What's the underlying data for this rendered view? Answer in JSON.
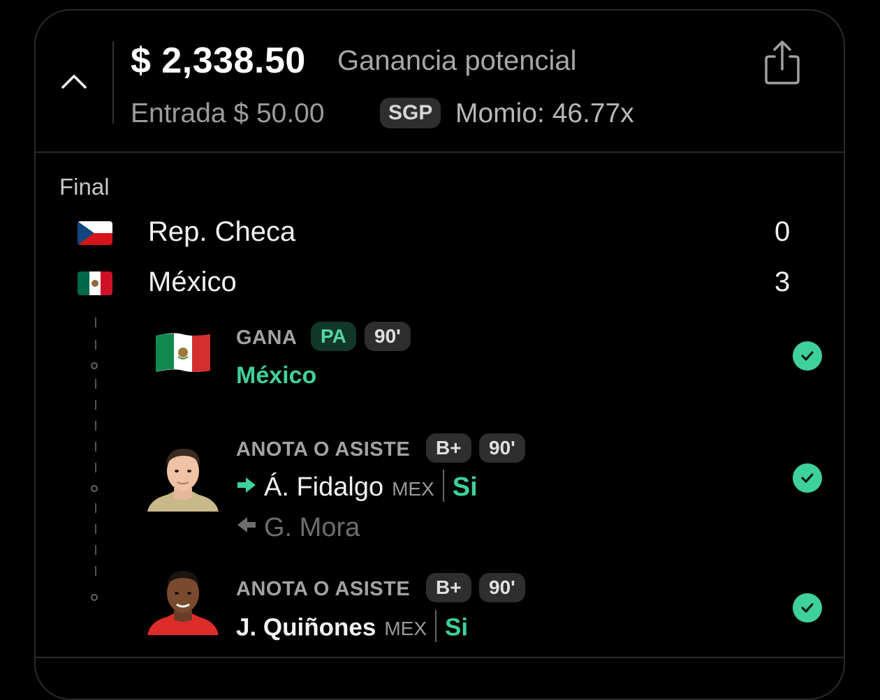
{
  "header": {
    "payout": "$ 2,338.50",
    "payout_label": "Ganancia potencial",
    "entry": "Entrada $ 50.00",
    "sgp_badge": "SGP",
    "odds": "Momio: 46.77x"
  },
  "match": {
    "status": "Final",
    "teams": [
      {
        "name": "Rep. Checa",
        "score": "0",
        "flag": "czech-flag"
      },
      {
        "name": "México",
        "score": "3",
        "flag": "mexico-flag"
      }
    ]
  },
  "legs": [
    {
      "market": "GANA",
      "badges": [
        "PA",
        "90'"
      ],
      "pick": "México",
      "result_icon": "check-circle-icon"
    },
    {
      "market": "ANOTA O ASISTE",
      "badges": [
        "B+",
        "90'"
      ],
      "player": "Á. Fidalgo",
      "team_code": "MEX",
      "pick": "Si",
      "replaced_player": "G. Mora",
      "in_icon": "arrow-right-icon",
      "out_icon": "arrow-left-icon",
      "result_icon": "check-circle-icon"
    },
    {
      "market": "ANOTA O ASISTE",
      "badges": [
        "B+",
        "90'"
      ],
      "player": "J. Quiñones",
      "team_code": "MEX",
      "pick": "Si",
      "result_icon": "check-circle-icon"
    }
  ],
  "colors": {
    "accent_green": "#3fd19b",
    "background": "#000000"
  }
}
